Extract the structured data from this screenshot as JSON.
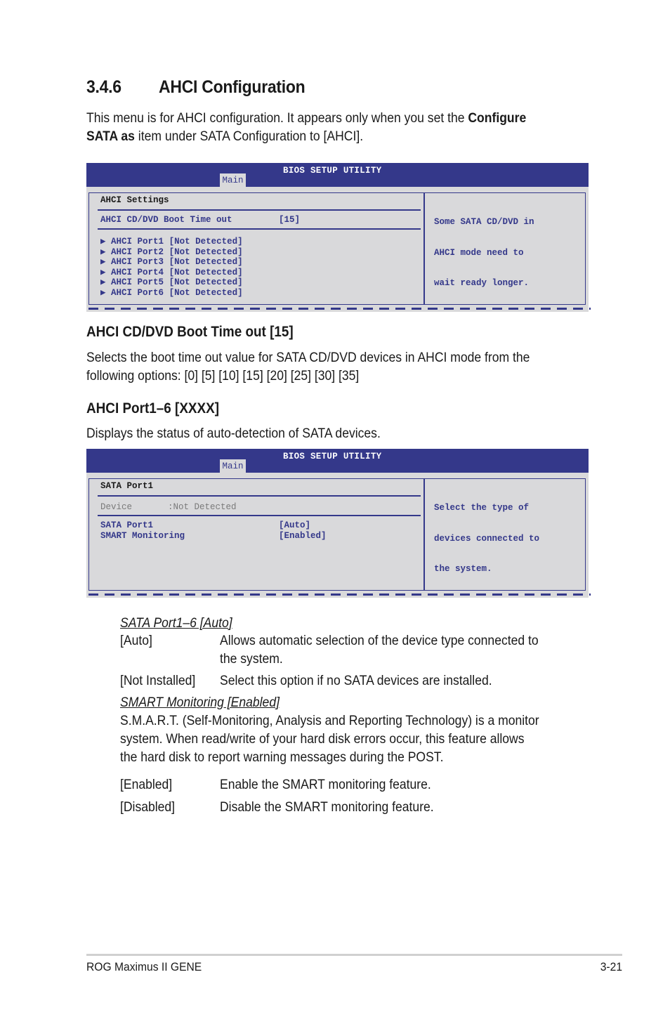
{
  "section": {
    "number": "3.4.6",
    "title": "AHCI Configuration",
    "intro_pre": "This menu is for AHCI configuration. It appears only when you set the ",
    "intro_bold1": "Configure",
    "intro_bold2": "SATA as",
    "intro_post": " item under SATA Configuration to [AHCI]."
  },
  "bios1": {
    "title": "BIOS SETUP UTILITY",
    "tab": "Main",
    "heading": "AHCI Settings",
    "boot_timeout_label": "AHCI CD/DVD Boot Time out",
    "boot_timeout_value": "[15]",
    "ports": [
      {
        "label": "AHCI Port1",
        "value": "[Not Detected]"
      },
      {
        "label": "AHCI Port2",
        "value": "[Not Detected]"
      },
      {
        "label": "AHCI Port3",
        "value": "[Not Detected]"
      },
      {
        "label": "AHCI Port4",
        "value": "[Not Detected]"
      },
      {
        "label": "AHCI Port5",
        "value": "[Not Detected]"
      },
      {
        "label": "AHCI Port6",
        "value": "[Not Detected]"
      }
    ],
    "arrow": "▶",
    "help": [
      "Some SATA CD/DVD in",
      "AHCI mode need to",
      "wait ready longer."
    ]
  },
  "boot_timeout_section": {
    "heading": "AHCI CD/DVD Boot Time out [15]",
    "line1": "Selects the boot time out value for SATA CD/DVD devices in AHCI mode from the",
    "line2": "following options: [0] [5] [10] [15] [20] [25] [30] [35]"
  },
  "port_section": {
    "heading": "AHCI Port1–6 [XXXX]",
    "text": "Displays the status of auto-detection of SATA devices."
  },
  "bios2": {
    "title": "BIOS SETUP UTILITY",
    "tab": "Main",
    "heading": "SATA Port1",
    "device_label": "Device",
    "device_value": ":Not Detected",
    "items": [
      {
        "label": "SATA Port1",
        "value": "[Auto]"
      },
      {
        "label": "SMART Monitoring",
        "value": "[Enabled]"
      }
    ],
    "help": [
      "Select the type of",
      "devices connected to",
      "the system."
    ]
  },
  "sata_port_opts": {
    "heading": "SATA Port1–6 [Auto]",
    "options": [
      {
        "key": "[Auto]",
        "desc1": "Allows automatic selection of the device type connected to",
        "desc2": "the system."
      },
      {
        "key": "[Not Installed]",
        "desc1": "Select this option if no SATA devices are installed."
      }
    ]
  },
  "smart_opts": {
    "heading": "SMART Monitoring [Enabled]",
    "text": [
      "S.M.A.R.T. (Self-Monitoring, Analysis and Reporting Technology) is a monitor",
      "system. When read/write of your hard disk errors occur, this feature allows",
      "the hard disk to report warning messages during the POST."
    ],
    "options": [
      {
        "key": "[Enabled]",
        "desc": "Enable the SMART monitoring feature."
      },
      {
        "key": "[Disabled]",
        "desc": "Disable the SMART monitoring feature."
      }
    ]
  },
  "footer": {
    "product": "ROG Maximus II GENE",
    "page": "3-21"
  }
}
